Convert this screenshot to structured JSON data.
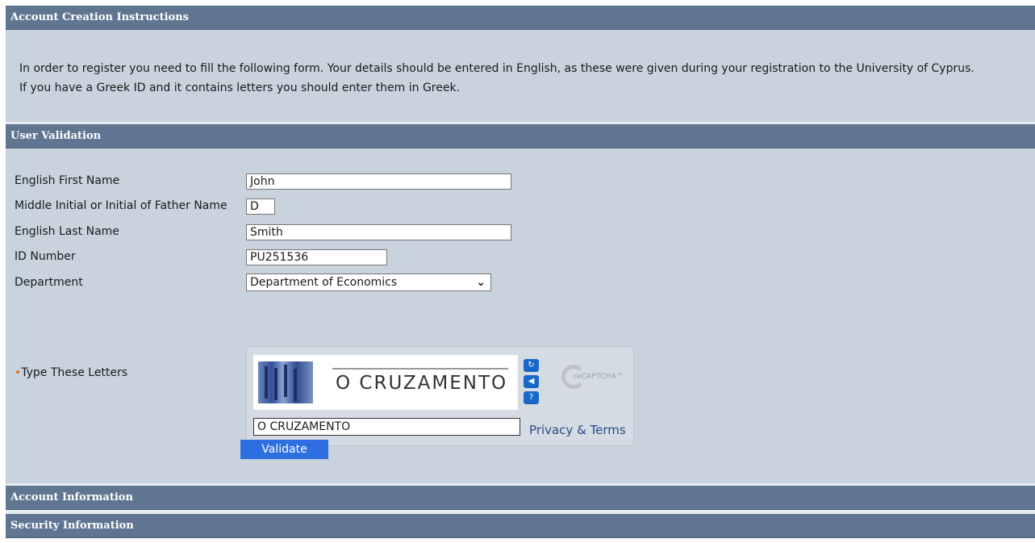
{
  "sections": {
    "instructions": "Account Creation Instructions",
    "validation": "User Validation",
    "account": "Account Information",
    "security": "Security Information"
  },
  "instructions_text_1": "In order to register you need to fill the following form. Your details should be entered in English, as these were given during your registration to the University of Cyprus.",
  "instructions_text_2": "If you have a Greek ID and it contains letters you should enter them in Greek.",
  "form": {
    "first_name_label": "English First Name",
    "first_name_value": "John",
    "middle_label": "Middle Initial or Initial of Father Name",
    "middle_value": "D",
    "last_name_label": "English Last Name",
    "last_name_value": "Smith",
    "id_label": "ID Number",
    "id_value": "PU251536",
    "department_label": "Department",
    "department_value": "Department of Economics",
    "captcha_label": "Type These Letters",
    "captcha_bullet": "•",
    "captcha_image_text": "O CRUZAMENTO",
    "captcha_value": "O CRUZAMENTO",
    "privacy_label": "Privacy & Terms",
    "recaptcha_brand": "reCAPTCHA™",
    "validate_label": "Validate"
  }
}
